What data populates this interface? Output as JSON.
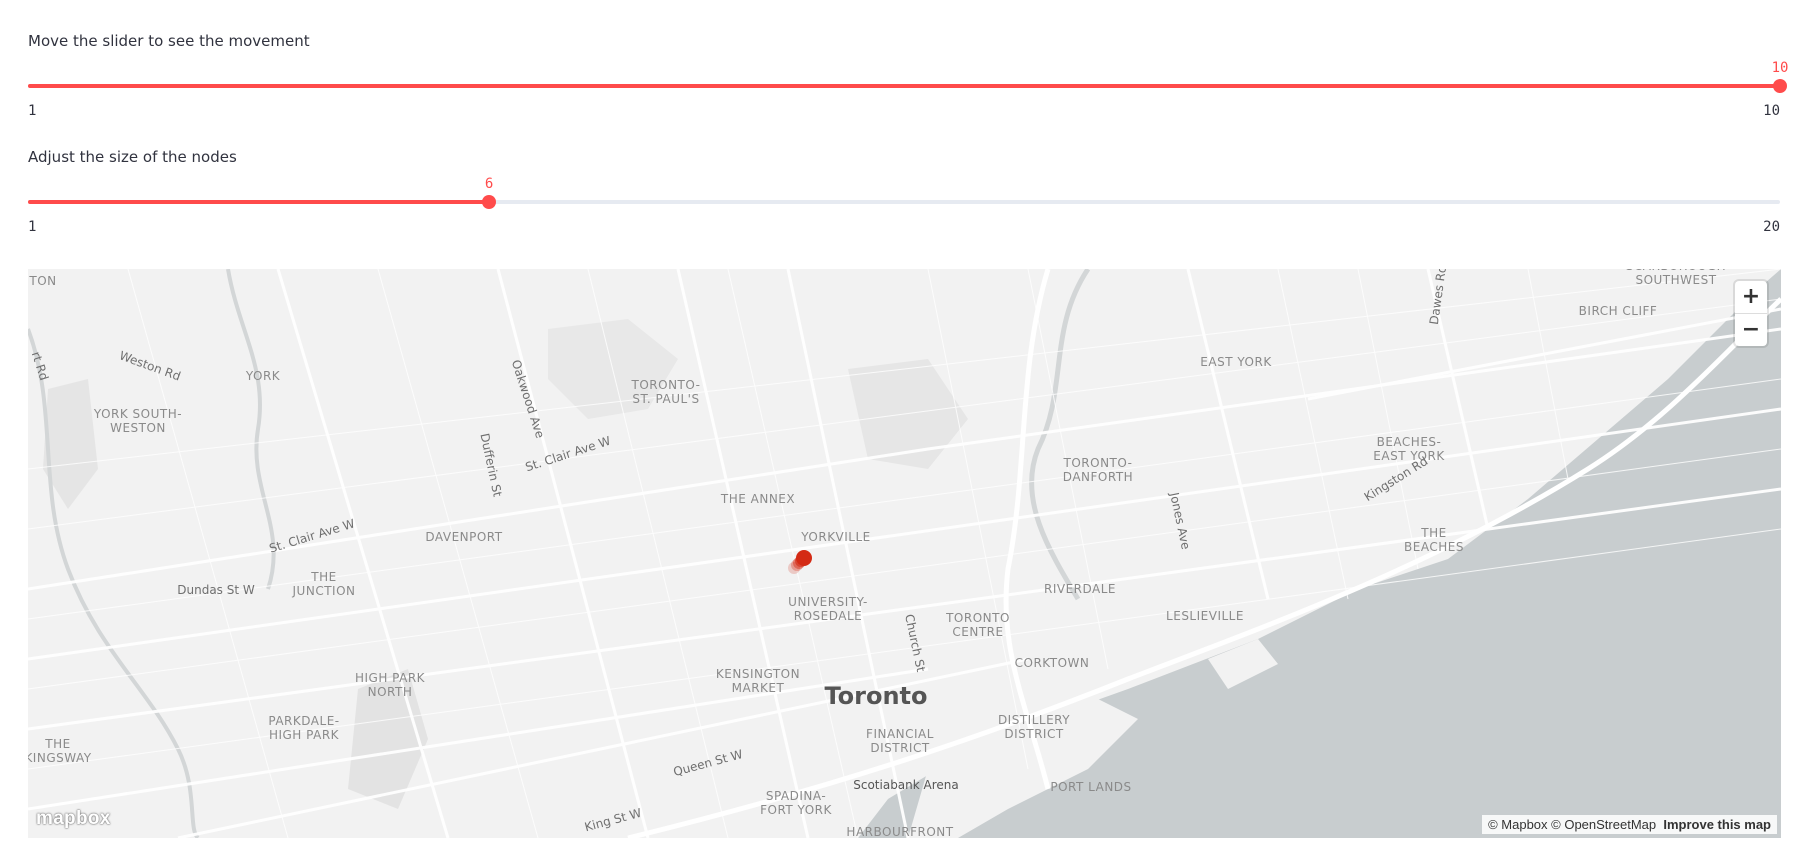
{
  "slider_movement": {
    "label": "Move the slider to see the movement",
    "min": 1,
    "max": 10,
    "value": 10,
    "min_label": "1",
    "max_label": "10",
    "value_label": "10"
  },
  "slider_size": {
    "label": "Adjust the size of the nodes",
    "min": 1,
    "max": 20,
    "value": 6,
    "min_label": "1",
    "max_label": "20",
    "value_label": "6"
  },
  "map": {
    "city": "Toronto",
    "neighbourhoods": [
      "TON",
      "YORK",
      "YORK SOUTH-\nWESTON",
      "TORONTO-\nST. PAUL'S",
      "THE ANNEX",
      "YORKVILLE",
      "DAVENPORT",
      "THE\nJUNCTION",
      "UNIVERSITY-\nROSEDALE",
      "TORONTO\nCENTRE",
      "KENSINGTON\nMARKET",
      "HIGH PARK\nNORTH",
      "PARKDALE-\nHIGH PARK",
      "THE\nKINGSWAY",
      "FINANCIAL\nDISTRICT",
      "DISTILLERY\nDISTRICT",
      "CORKTOWN",
      "SPADINA-\nFORT YORK",
      "HARBOURFRONT",
      "PORT LANDS",
      "RIVERDALE",
      "LESLIEVILLE",
      "TORONTO-\nDANFORTH",
      "EAST YORK",
      "BEACHES-\nEAST YORK",
      "THE\nBEACHES",
      "BIRCH CLIFF",
      "SCARBOROUGH\nSOUTHWEST"
    ],
    "streets": [
      "Weston Rd",
      "Oakwood Ave",
      "Dufferin St",
      "St. Clair Ave W",
      "St. Clair Ave W",
      "Dundas St W",
      "Church St",
      "Jones Ave",
      "Kingston Rd",
      "Queen St W",
      "King St W",
      "Dawes Rd",
      "rt Rd"
    ],
    "venue": "Scotiabank Arena",
    "zoom_in": "+",
    "zoom_out": "−",
    "attribution": "© Mapbox © OpenStreetMap",
    "improve_link": "Improve this map",
    "logo": "mapbox",
    "marker_color": "#d42a14"
  }
}
